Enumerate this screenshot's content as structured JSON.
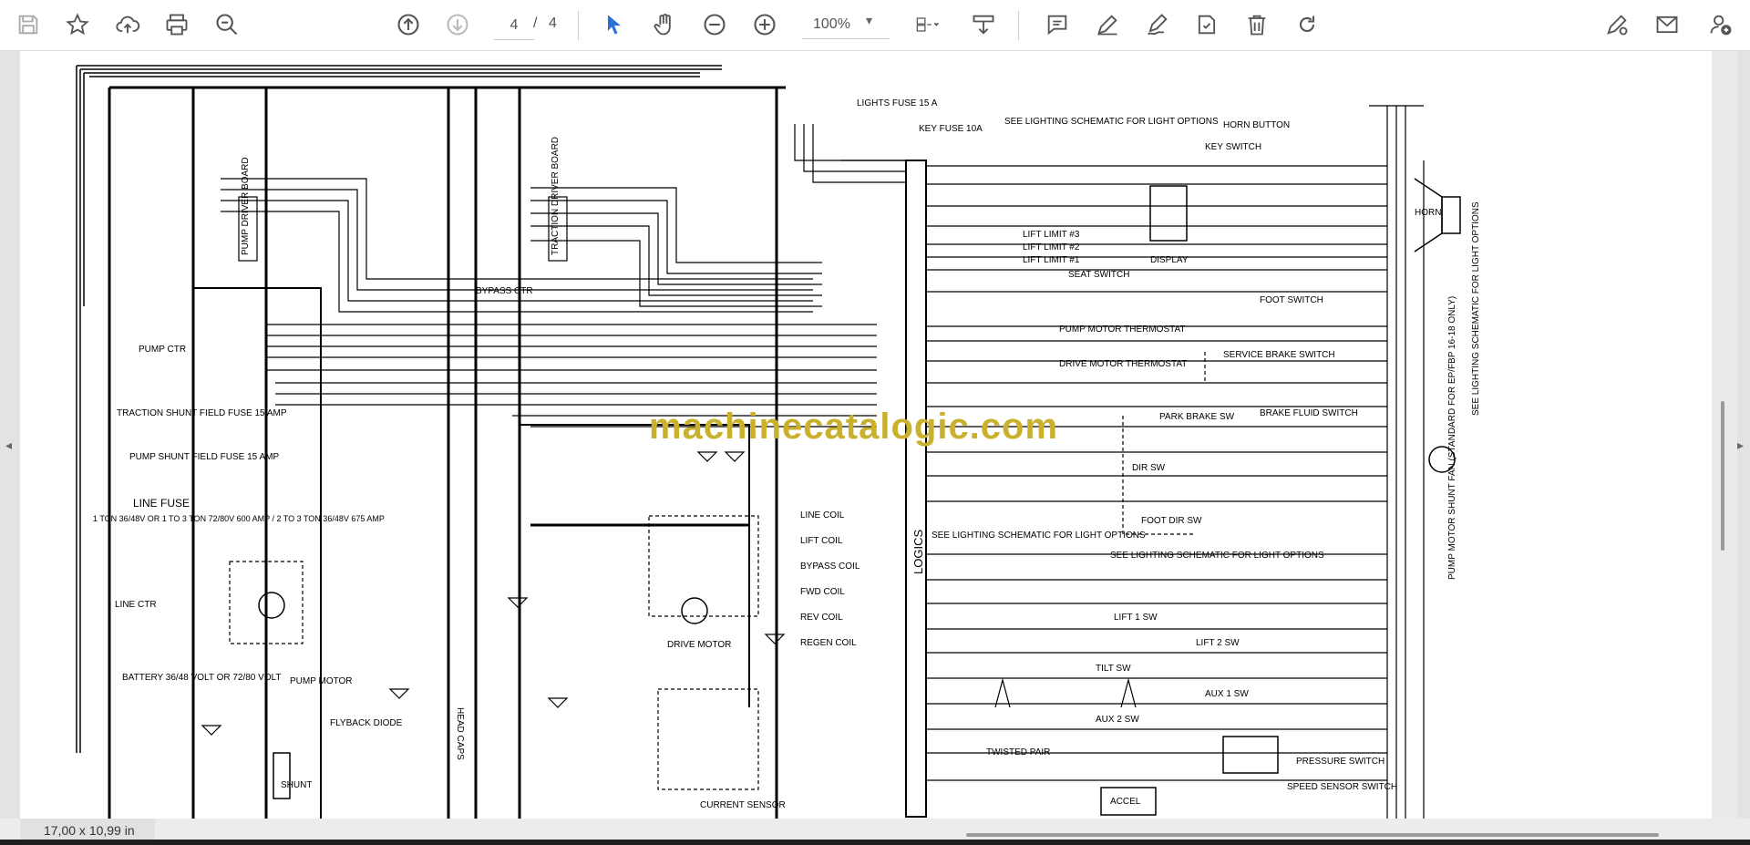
{
  "toolbar": {
    "tools": [
      {
        "name": "save-button",
        "icon": "save-icon"
      },
      {
        "name": "bookmark-button",
        "icon": "star-icon"
      },
      {
        "name": "upload-button",
        "icon": "cloud-upload-icon"
      },
      {
        "name": "print-button",
        "icon": "printer-icon"
      },
      {
        "name": "zoom-out-search-button",
        "icon": "zoom-search-icon"
      },
      {
        "name": "prev-page-button",
        "icon": "arrow-up-circle-icon"
      },
      {
        "name": "next-page-button",
        "icon": "arrow-down-circle-icon"
      },
      {
        "name": "select-tool-button",
        "icon": "pointer-icon"
      },
      {
        "name": "hand-tool-button",
        "icon": "hand-icon"
      },
      {
        "name": "zoom-out-button",
        "icon": "minus-circle-icon"
      },
      {
        "name": "zoom-in-button",
        "icon": "plus-circle-icon"
      },
      {
        "name": "fit-page-button",
        "icon": "fit-page-icon"
      },
      {
        "name": "download-button",
        "icon": "download-tray-icon"
      },
      {
        "name": "comment-button",
        "icon": "comment-icon"
      },
      {
        "name": "highlight-button",
        "icon": "pen-icon"
      },
      {
        "name": "sign-button",
        "icon": "signature-pen-icon"
      },
      {
        "name": "stamp-button",
        "icon": "stamp-icon"
      },
      {
        "name": "delete-button",
        "icon": "trash-icon"
      },
      {
        "name": "redo-button",
        "icon": "redo-icon"
      },
      {
        "name": "edit-button",
        "icon": "edit-pencil-icon"
      },
      {
        "name": "email-button",
        "icon": "envelope-icon"
      },
      {
        "name": "account-button",
        "icon": "user-add-icon"
      }
    ],
    "page_current": "4",
    "page_separator": "/",
    "page_total": "4",
    "zoom": "100%"
  },
  "status": {
    "page_size": "17,00 x 10,99 in"
  },
  "watermark": "machinecatalogic.com",
  "schematic": {
    "logics": "LOGICS",
    "labels": {
      "lights_fuse": "LIGHTS FUSE 15 A",
      "key_fuse": "KEY FUSE 10A",
      "see_lighting": "SEE LIGHTING SCHEMATIC FOR LIGHT OPTIONS",
      "horn_button": "HORN BUTTON",
      "key_switch": "KEY SWITCH",
      "display": "DISPLAY",
      "horn": "HORN",
      "lift3": "LIFT LIMIT #3",
      "lift2": "LIFT LIMIT #2",
      "lift1": "LIFT LIMIT #1",
      "seat_switch": "SEAT SWITCH",
      "foot_switch": "FOOT SWITCH",
      "pump_thermo": "PUMP MOTOR THERMOSTAT",
      "drive_thermo": "DRIVE MOTOR THERMOSTAT",
      "service_brake": "SERVICE BRAKE SWITCH",
      "park_brake": "PARK BRAKE SW",
      "brake_fluid": "BRAKE FLUID SWITCH",
      "dir_sw": "DIR SW",
      "foot_dir_sw": "FOOT DIR SW",
      "lift1_sw": "LIFT 1 SW",
      "lift2_sw": "LIFT 2 SW",
      "tilt_sw": "TILT SW",
      "aux1_sw": "AUX 1 SW",
      "aux2_sw": "AUX 2 SW",
      "twisted_pair": "TWISTED PAIR",
      "pressure_switch": "PRESSURE SWITCH",
      "speed_sensor": "SPEED SENSOR SWITCH",
      "accel": "ACCEL",
      "pump_driver": "PUMP DRIVER BOARD",
      "traction_driver": "TRACTION DRIVER BOARD",
      "bypass_ctr": "BYPASS CTR",
      "pump_ctr": "PUMP CTR",
      "traction_fuse": "TRACTION SHUNT FIELD FUSE 15 AMP",
      "pump_fuse": "PUMP SHUNT FIELD FUSE 15 AMP",
      "line_fuse": "LINE FUSE",
      "line_fuse_spec": "1 TON 36/48V OR 1 TO 3 TON 72/80V 600 AMP / 2 TO 3 TON 36/48V 675 AMP",
      "line_ctr": "LINE CTR",
      "battery": "BATTERY 36/48 VOLT OR 72/80 VOLT",
      "pump_motor": "PUMP MOTOR",
      "flyback": "FLYBACK DIODE",
      "head_caps": "HEAD CAPS",
      "shunt": "SHUNT",
      "drive_motor": "DRIVE MOTOR",
      "current_sensor": "CURRENT SENSOR",
      "line_coil": "LINE COIL",
      "lift_coil": "LIFT COIL",
      "bypass_coil": "BYPASS COIL",
      "fwd_coil": "FWD COIL",
      "rev_coil": "REV COIL",
      "regen_coil": "REGEN COIL",
      "pump_motor_fan": "PUMP MOTOR SHUNT FAN (STANDARD FOR EP/FBP 16-18 ONLY)",
      "see_lighting_side": "SEE LIGHTING SCHEMATIC FOR LIGHT OPTIONS"
    }
  }
}
